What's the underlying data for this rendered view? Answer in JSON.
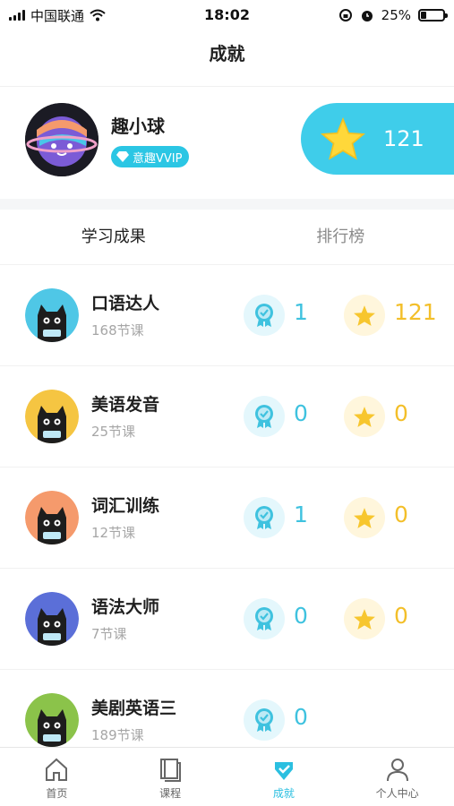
{
  "status_bar": {
    "carrier": "中国联通",
    "time": "18:02",
    "battery_text": "25%",
    "battery_level": 0.25
  },
  "nav": {
    "title": "成就"
  },
  "profile": {
    "name": "趣小球",
    "vip_label": "意趣VVIP",
    "star_total": "121"
  },
  "tabs": [
    {
      "label": "学习成果"
    },
    {
      "label": "排行榜"
    }
  ],
  "courses": [
    {
      "title": "口语达人",
      "lessons": "168节课",
      "medals": "1",
      "stars": "121",
      "bg": "#4fc7e6"
    },
    {
      "title": "美语发音",
      "lessons": "25节课",
      "medals": "0",
      "stars": "0",
      "bg": "#f5c542"
    },
    {
      "title": "词汇训练",
      "lessons": "12节课",
      "medals": "1",
      "stars": "0",
      "bg": "#f59a6c"
    },
    {
      "title": "语法大师",
      "lessons": "7节课",
      "medals": "0",
      "stars": "0",
      "bg": "#5b6fd8"
    },
    {
      "title": "美剧英语三",
      "lessons": "189节课",
      "medals": "0",
      "bg": "#8bc34a"
    }
  ],
  "tab_bar": [
    {
      "label": "首页",
      "icon": "home-icon"
    },
    {
      "label": "课程",
      "icon": "book-icon"
    },
    {
      "label": "成就",
      "icon": "medal-icon"
    },
    {
      "label": "个人中心",
      "icon": "person-icon"
    }
  ],
  "colors": {
    "accent": "#3fcdea",
    "medal": "#3fc2df",
    "star": "#f3bf2a"
  }
}
